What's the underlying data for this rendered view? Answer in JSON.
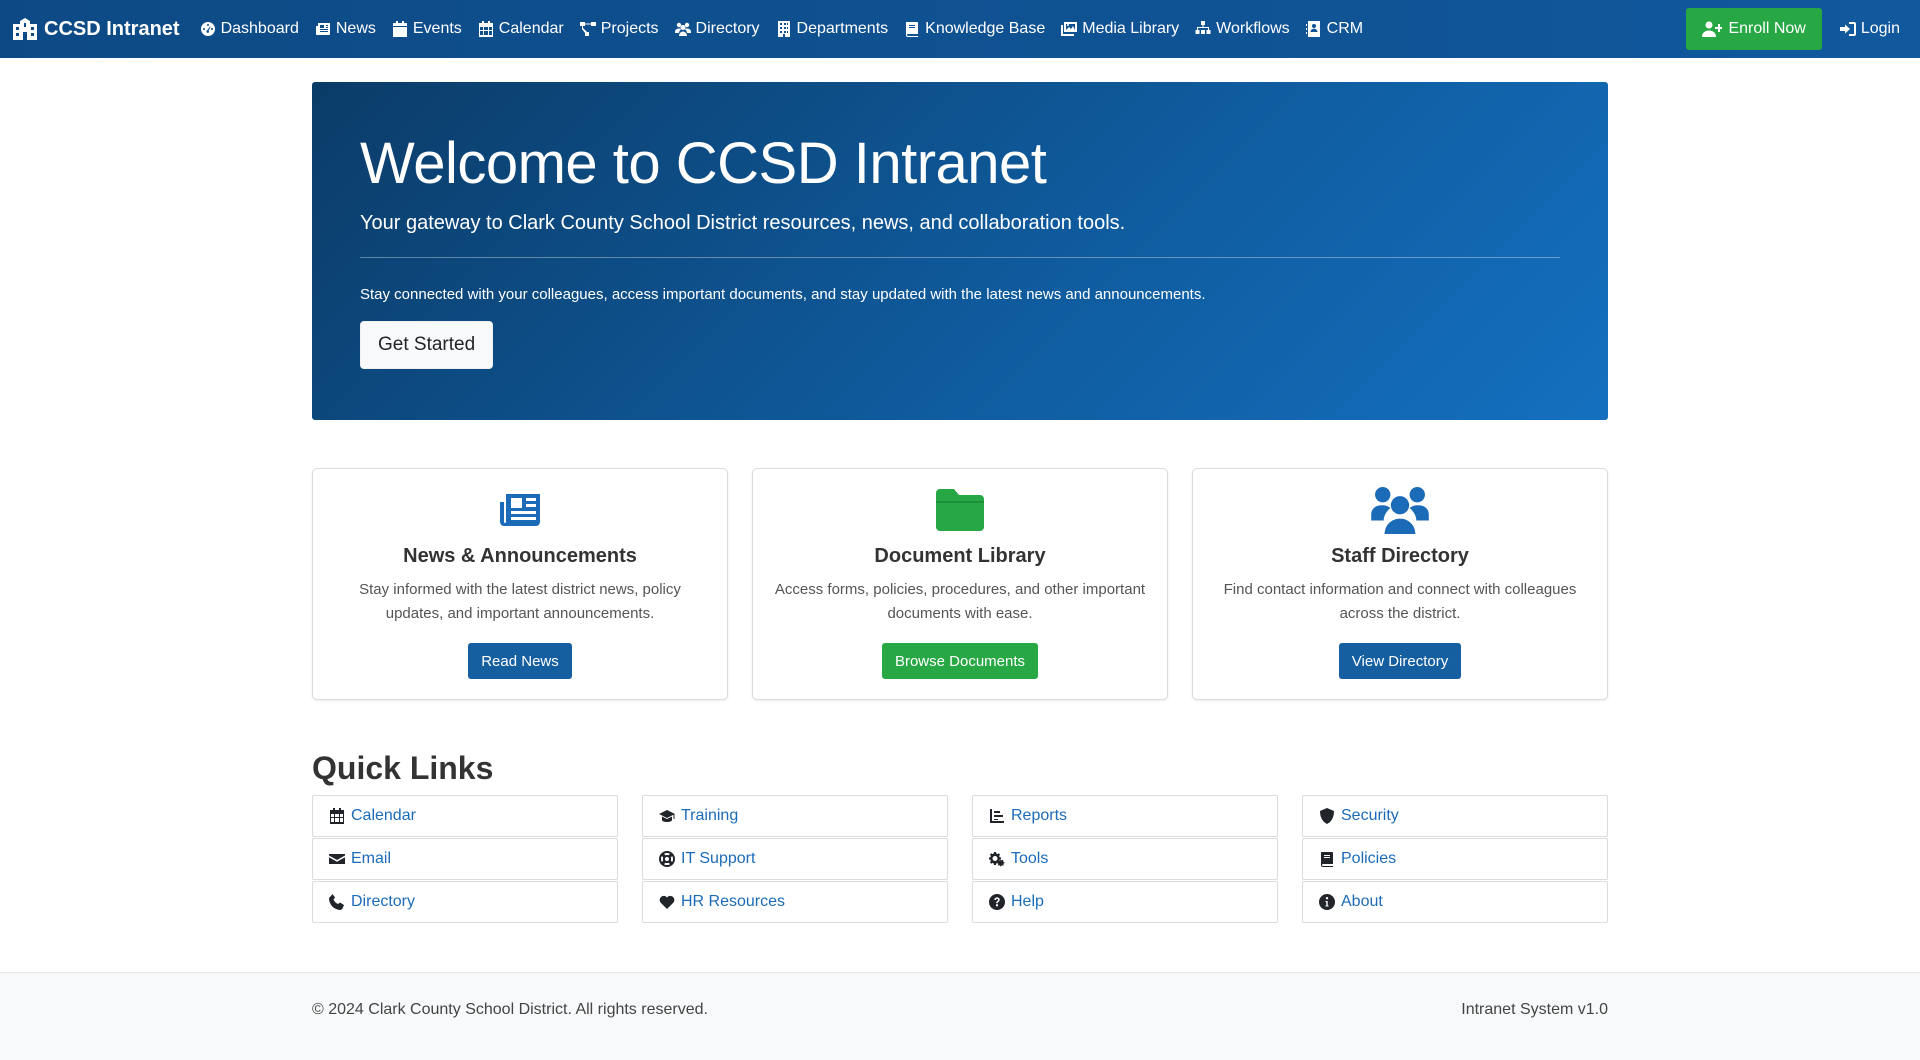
{
  "navbar": {
    "brand": "CCSD Intranet",
    "items": [
      {
        "label": "Dashboard",
        "icon": "dashboard-icon"
      },
      {
        "label": "News",
        "icon": "newspaper-icon"
      },
      {
        "label": "Events",
        "icon": "calendar-event-icon"
      },
      {
        "label": "Calendar",
        "icon": "calendar-icon"
      },
      {
        "label": "Projects",
        "icon": "project-diagram-icon"
      },
      {
        "label": "Directory",
        "icon": "users-icon"
      },
      {
        "label": "Departments",
        "icon": "building-icon"
      },
      {
        "label": "Knowledge Base",
        "icon": "book-icon"
      },
      {
        "label": "Media Library",
        "icon": "photo-icon"
      },
      {
        "label": "Workflows",
        "icon": "sitemap-icon"
      },
      {
        "label": "CRM",
        "icon": "address-card-icon"
      }
    ],
    "enroll_label": "Enroll Now",
    "login_label": "Login"
  },
  "hero": {
    "title": "Welcome to CCSD Intranet",
    "subtitle": "Your gateway to Clark County School District resources, news, and collaboration tools.",
    "text": "Stay connected with your colleagues, access important documents, and stay updated with the latest news and announcements.",
    "button_label": "Get Started"
  },
  "cards": [
    {
      "title": "News & Announcements",
      "text": "Stay informed with the latest district news, policy updates, and important announcements.",
      "button_label": "Read News",
      "icon": "newspaper-icon",
      "color": "#1b6bb8",
      "button_color": "#155fa0"
    },
    {
      "title": "Document Library",
      "text": "Access forms, policies, procedures, and other important documents with ease.",
      "button_label": "Browse Documents",
      "icon": "folder-icon",
      "color": "#28a745",
      "button_color": "#28a745"
    },
    {
      "title": "Staff Directory",
      "text": "Find contact information and connect with colleagues across the district.",
      "button_label": "View Directory",
      "icon": "users-icon",
      "color": "#1b6bb8",
      "button_color": "#155fa0"
    }
  ],
  "quick_links": {
    "title": "Quick Links",
    "items": [
      {
        "label": "Calendar",
        "icon": "calendar-icon"
      },
      {
        "label": "Training",
        "icon": "graduation-cap-icon"
      },
      {
        "label": "Reports",
        "icon": "chart-icon"
      },
      {
        "label": "Security",
        "icon": "shield-icon"
      },
      {
        "label": "Email",
        "icon": "envelope-icon"
      },
      {
        "label": "IT Support",
        "icon": "lifebuoy-icon"
      },
      {
        "label": "Tools",
        "icon": "gears-icon"
      },
      {
        "label": "Policies",
        "icon": "book-icon"
      },
      {
        "label": "Directory",
        "icon": "phone-icon"
      },
      {
        "label": "HR Resources",
        "icon": "heart-icon"
      },
      {
        "label": "Help",
        "icon": "question-circle-icon"
      },
      {
        "label": "About",
        "icon": "info-circle-icon"
      }
    ]
  },
  "footer": {
    "copyright": "© 2024 Clark County School District. All rights reserved.",
    "version": "Intranet System v1.0"
  },
  "colors": {
    "navbar": "#0d4a85",
    "primary": "#1b6bb8",
    "success": "#28a745",
    "link": "#1b6bb8"
  }
}
